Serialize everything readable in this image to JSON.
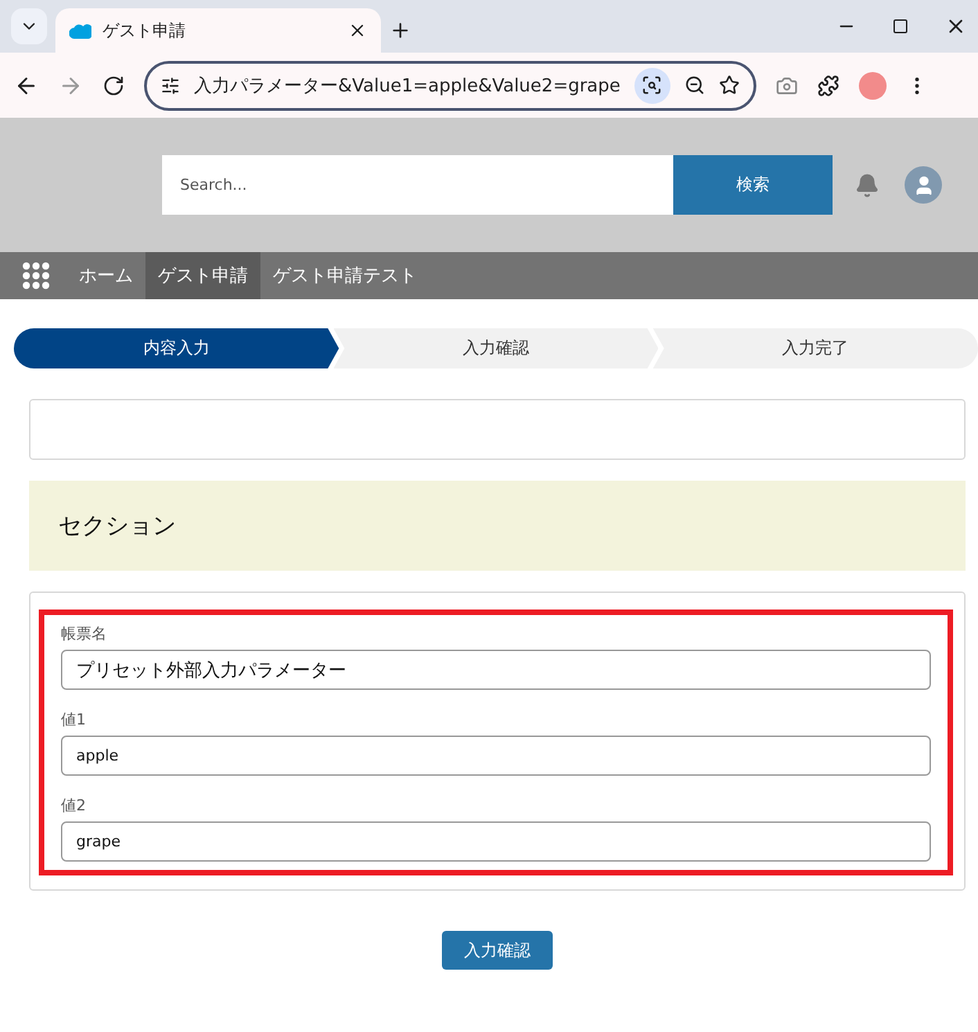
{
  "browser": {
    "tab_title": "ゲスト申請",
    "url": "入力パラメーター&Value1=apple&Value2=grape"
  },
  "header": {
    "search": {
      "placeholder": "Search..."
    },
    "search_button": "検索"
  },
  "nav": {
    "items": [
      {
        "label": "ホーム",
        "selected": false
      },
      {
        "label": "ゲスト申請",
        "selected": true
      },
      {
        "label": "ゲスト申請テスト",
        "selected": false
      }
    ]
  },
  "path": {
    "steps": [
      {
        "label": "内容入力",
        "selected": true
      },
      {
        "label": "入力確認",
        "selected": false
      },
      {
        "label": "入力完了",
        "selected": false
      }
    ]
  },
  "section": {
    "title": "セクション"
  },
  "form": {
    "highlighted": true,
    "fields": [
      {
        "label": "帳票名",
        "value": "プリセット外部入力パラメーター",
        "kind": "large"
      },
      {
        "label": "値1",
        "value": "apple",
        "kind": "small"
      },
      {
        "label": "値2",
        "value": "grape",
        "kind": "small"
      }
    ]
  },
  "submit_button": "入力確認"
}
